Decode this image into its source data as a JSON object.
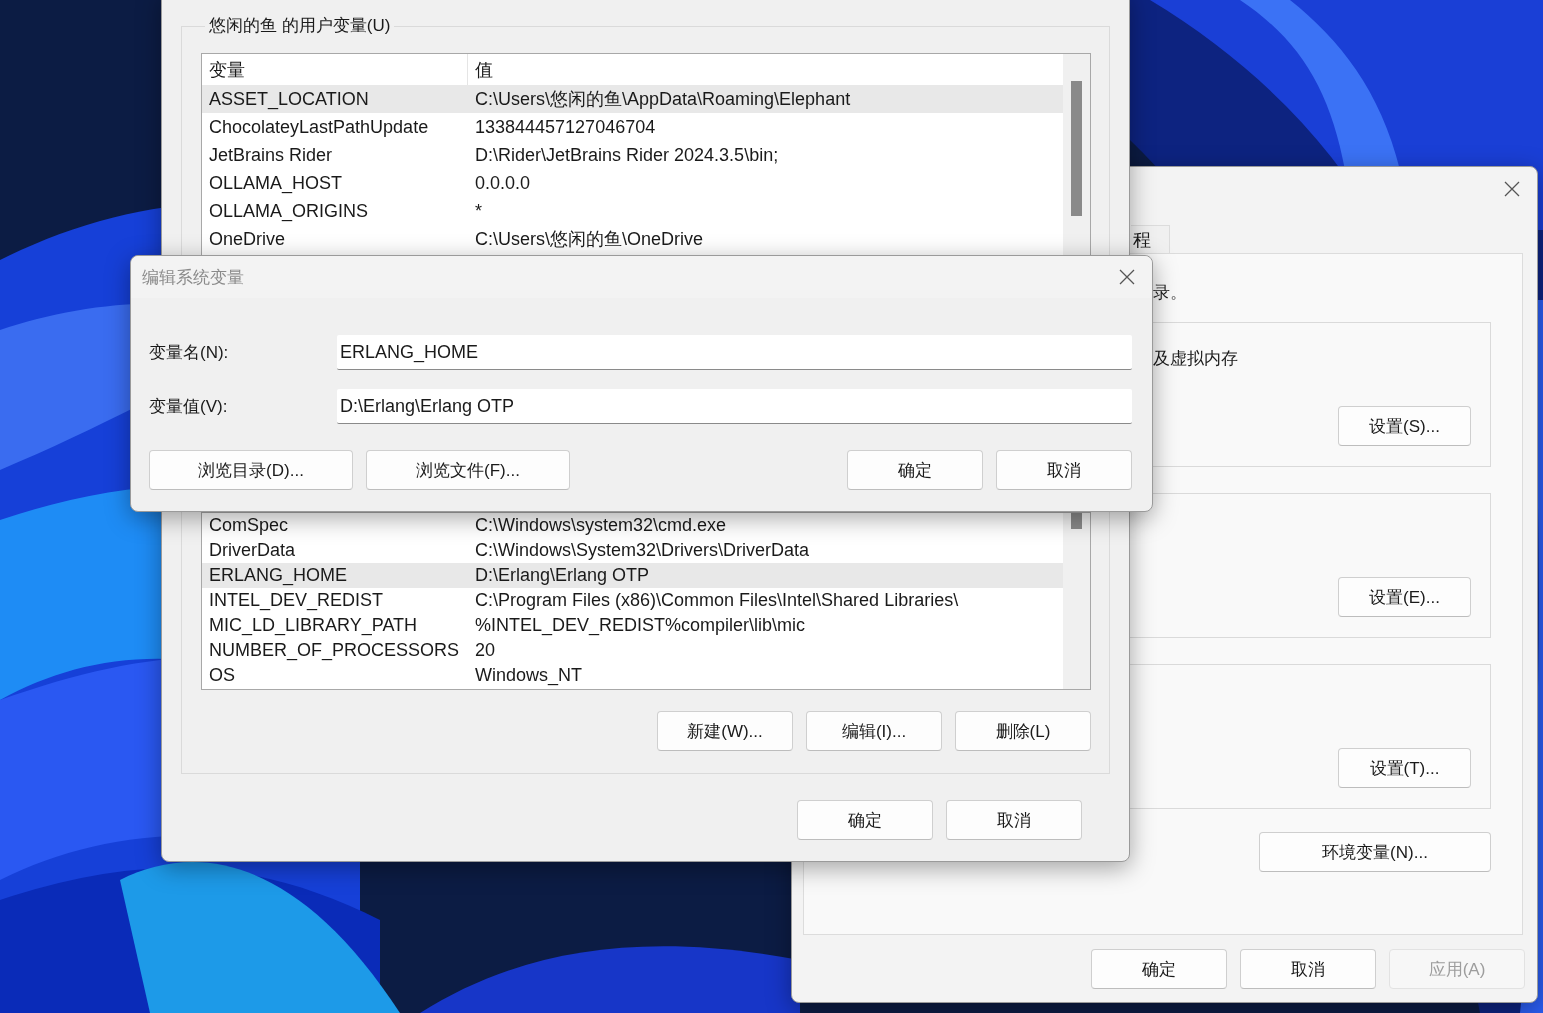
{
  "system_properties": {
    "tabs": [
      {
        "label": "程",
        "selected": false
      }
    ],
    "intro_text": "录。",
    "groups": [
      {
        "text": "及虚拟内存",
        "button": "设置(S)..."
      },
      {
        "button": "设置(E)..."
      },
      {
        "button": "设置(T)..."
      }
    ],
    "env_button": "环境变量(N)...",
    "buttons": [
      {
        "label": "确定",
        "disabled": false
      },
      {
        "label": "取消",
        "disabled": false
      },
      {
        "label": "应用(A)",
        "disabled": true
      }
    ]
  },
  "environment_variables": {
    "user_group_label": "悠闲的鱼 的用户变量(U)",
    "user_columns": [
      "变量",
      "值"
    ],
    "user_rows": [
      {
        "name": "ASSET_LOCATION",
        "value": "C:\\Users\\悠闲的鱼\\AppData\\Roaming\\Elephant",
        "selected": true
      },
      {
        "name": "ChocolateyLastPathUpdate",
        "value": "133844457127046704",
        "selected": false
      },
      {
        "name": "JetBrains Rider",
        "value": "D:\\Rider\\JetBrains Rider 2024.3.5\\bin;",
        "selected": false
      },
      {
        "name": "OLLAMA_HOST",
        "value": "0.0.0.0",
        "selected": false
      },
      {
        "name": "OLLAMA_ORIGINS",
        "value": "*",
        "selected": false
      },
      {
        "name": "OneDrive",
        "value": "C:\\Users\\悠闲的鱼\\OneDrive",
        "selected": false
      }
    ],
    "system_rows": [
      {
        "name": "ComSpec",
        "value": "C:\\Windows\\system32\\cmd.exe",
        "selected": false
      },
      {
        "name": "DriverData",
        "value": "C:\\Windows\\System32\\Drivers\\DriverData",
        "selected": false
      },
      {
        "name": "ERLANG_HOME",
        "value": "D:\\Erlang\\Erlang OTP",
        "selected": true
      },
      {
        "name": "INTEL_DEV_REDIST",
        "value": "C:\\Program Files (x86)\\Common Files\\Intel\\Shared Libraries\\",
        "selected": false
      },
      {
        "name": "MIC_LD_LIBRARY_PATH",
        "value": "%INTEL_DEV_REDIST%compiler\\lib\\mic",
        "selected": false
      },
      {
        "name": "NUMBER_OF_PROCESSORS",
        "value": "20",
        "selected": false
      },
      {
        "name": "OS",
        "value": "Windows_NT",
        "selected": false
      }
    ],
    "system_buttons": [
      "新建(W)...",
      "编辑(I)...",
      "删除(L)"
    ],
    "buttons": [
      "确定",
      "取消"
    ]
  },
  "edit_dialog": {
    "title": "编辑系统变量",
    "active": false,
    "fields": [
      {
        "label": "变量名(N):",
        "value": "ERLANG_HOME"
      },
      {
        "label": "变量值(V):",
        "value": "D:\\Erlang\\Erlang OTP"
      }
    ],
    "browse_buttons": [
      "浏览目录(D)...",
      "浏览文件(F)..."
    ],
    "buttons": [
      "确定",
      "取消"
    ]
  }
}
